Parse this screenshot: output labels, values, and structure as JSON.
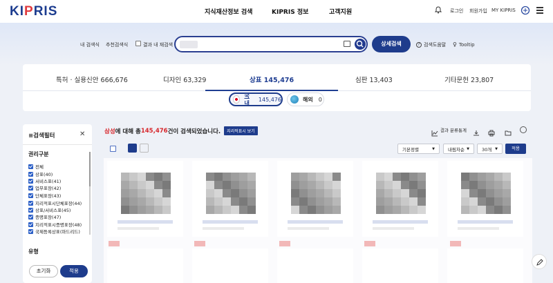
{
  "brand": {
    "logo_text_a": "KI",
    "logo_text_b": "P",
    "logo_text_c": "RIS"
  },
  "nav": {
    "main": [
      "지식재산정보 검색",
      "KIPRIS 정보",
      "고객지원"
    ],
    "util": [
      "로그인",
      "회원가입",
      "MY KIPRIS"
    ]
  },
  "search": {
    "my_search": "내 검색식",
    "recommended": "추천검색식",
    "within_results": "결과 내 재검색",
    "advanced": "상세검색",
    "help": "검색도움말",
    "tooltip": "Tooltip"
  },
  "categories": [
    {
      "label": "특허 · 실용신안 666,676"
    },
    {
      "label": "디자인 63,329"
    },
    {
      "label": "상표 145,476",
      "active": true
    },
    {
      "label": "심판 13,403"
    },
    {
      "label": "기타문헌 23,807"
    }
  ],
  "region": {
    "domestic_label": "국내",
    "domestic_count": "145,476",
    "foreign_label": "해외",
    "foreign_count": "0"
  },
  "filter": {
    "title": "≡검색필터",
    "close": "✕",
    "section_rights": "권리구분",
    "items": [
      "전체",
      "상표(40)",
      "서비스표(41)",
      "업무표장(42)",
      "단체표장(43)",
      "지리적표시단체표장(44)",
      "상표/서비스표(45)",
      "증명표장(47)",
      "지리적표시증명표장(48)",
      "국제등록상표(마드리드)"
    ],
    "section_type": "유형",
    "reset": "초기화",
    "apply": "적용"
  },
  "results": {
    "keyword": "삼성",
    "text1": "에 대해 총 ",
    "count": "145,476",
    "text2": "건이 검색되었습니다.",
    "map_button": "지리적표시 보기",
    "stats": "결과 분류통계"
  },
  "controls": {
    "sort": "기본정렬",
    "order": "내림차순",
    "per_page": "30개",
    "apply": "적용"
  }
}
